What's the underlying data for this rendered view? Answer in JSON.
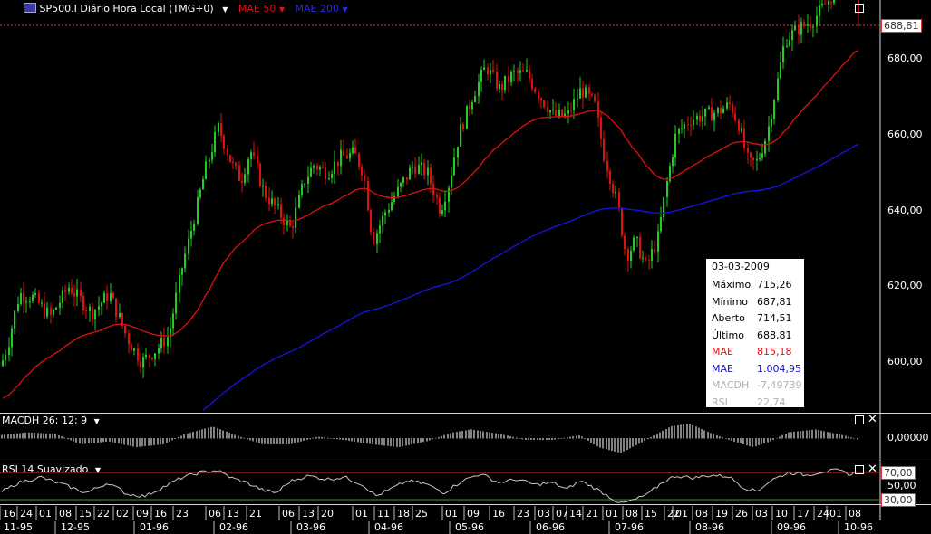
{
  "header": {
    "symbol_icon": "chart-symbol-icon",
    "title": "SP500.I Diário Hora Local (TMG+0)",
    "mae50_label": "MAE 50",
    "mae200_label": "MAE 200"
  },
  "colors": {
    "up": "#22cc22",
    "down": "#e01010",
    "mae50": "#e01010",
    "mae200": "#1010e0",
    "background": "#000000",
    "tooltip": "#ffffff"
  },
  "price_panel": {
    "last_price_tag": "688,81",
    "y_ticks": [
      "680,00",
      "660,00",
      "640,00",
      "620,00",
      "600,00"
    ]
  },
  "macd_panel": {
    "label": "MACDH 26; 12; 9",
    "zero_tick": "0,00000"
  },
  "rsi_panel": {
    "label": "RSI 14 Suavizado",
    "tick_70": "70,00",
    "tick_50": "50,00",
    "tick_30": "30,00"
  },
  "tooltip": {
    "date": "03-03-2009",
    "rows": [
      {
        "label": "Máximo",
        "value": "715,26",
        "color": "#000000"
      },
      {
        "label": "Mínimo",
        "value": "687,81",
        "color": "#000000"
      },
      {
        "label": "Aberto",
        "value": "714,51",
        "color": "#000000"
      },
      {
        "label": "Último",
        "value": "688,81",
        "color": "#000000"
      },
      {
        "label": "MAE",
        "value": "815,18",
        "color": "#e01010"
      },
      {
        "label": "MAE",
        "value": "1.004,95",
        "color": "#1010c0"
      },
      {
        "label": "MACDH",
        "value": "-7,49739",
        "color": "#b0b0b0"
      },
      {
        "label": "RSI",
        "value": "22,74",
        "color": "#b0b0b0"
      }
    ]
  },
  "chart_data": {
    "type": "candlestick",
    "ylim": [
      590,
      695
    ],
    "x_day_labels": [
      "16",
      "24",
      "01",
      "08",
      "15",
      "22",
      "02",
      "09",
      "16",
      "23",
      "06",
      "13",
      "21",
      "06",
      "13",
      "20",
      "01",
      "11",
      "18",
      "25",
      "01",
      "09",
      "16",
      "23",
      "03",
      "07",
      "14",
      "21",
      "01",
      "08",
      "15",
      "22",
      "01",
      "08",
      "19",
      "26",
      "03",
      "10",
      "17",
      "24",
      "01",
      "08"
    ],
    "x_month_labels": [
      "11-95",
      "12-95",
      "01-96",
      "02-96",
      "03-96",
      "04-96",
      "05-96",
      "06-96",
      "07-96",
      "08-96",
      "09-96",
      "10-96"
    ],
    "close_anchors": [
      [
        0,
        599
      ],
      [
        8,
        605
      ],
      [
        20,
        618
      ],
      [
        35,
        617
      ],
      [
        55,
        612
      ],
      [
        75,
        620
      ],
      [
        100,
        613
      ],
      [
        120,
        618
      ],
      [
        140,
        606
      ],
      [
        155,
        600
      ],
      [
        170,
        603
      ],
      [
        185,
        607
      ],
      [
        200,
        625
      ],
      [
        215,
        640
      ],
      [
        225,
        650
      ],
      [
        240,
        662
      ],
      [
        255,
        652
      ],
      [
        265,
        648
      ],
      [
        275,
        656
      ],
      [
        290,
        645
      ],
      [
        305,
        640
      ],
      [
        320,
        635
      ],
      [
        335,
        648
      ],
      [
        345,
        652
      ],
      [
        360,
        650
      ],
      [
        375,
        654
      ],
      [
        390,
        655
      ],
      [
        400,
        650
      ],
      [
        410,
        632
      ],
      [
        425,
        640
      ],
      [
        440,
        646
      ],
      [
        455,
        652
      ],
      [
        470,
        650
      ],
      [
        485,
        640
      ],
      [
        495,
        648
      ],
      [
        505,
        660
      ],
      [
        520,
        670
      ],
      [
        535,
        678
      ],
      [
        550,
        672
      ],
      [
        565,
        676
      ],
      [
        580,
        676
      ],
      [
        595,
        670
      ],
      [
        610,
        665
      ],
      [
        625,
        665
      ],
      [
        640,
        672
      ],
      [
        655,
        668
      ],
      [
        665,
        655
      ],
      [
        680,
        642
      ],
      [
        690,
        628
      ],
      [
        700,
        632
      ],
      [
        712,
        625
      ],
      [
        725,
        633
      ],
      [
        735,
        648
      ],
      [
        745,
        660
      ],
      [
        760,
        664
      ],
      [
        775,
        665
      ],
      [
        790,
        666
      ],
      [
        805,
        668
      ],
      [
        815,
        662
      ],
      [
        825,
        652
      ],
      [
        835,
        653
      ],
      [
        845,
        660
      ],
      [
        855,
        672
      ],
      [
        865,
        685
      ],
      [
        880,
        688
      ],
      [
        895,
        690
      ],
      [
        905,
        693
      ],
      [
        915,
        696
      ],
      [
        925,
        700
      ],
      [
        940,
        702
      ],
      [
        948,
        689
      ]
    ],
    "macd_anchors": [
      [
        0,
        1
      ],
      [
        30,
        2
      ],
      [
        60,
        1.5
      ],
      [
        90,
        -2
      ],
      [
        120,
        -1
      ],
      [
        150,
        -3
      ],
      [
        180,
        -2
      ],
      [
        205,
        1.5
      ],
      [
        235,
        4
      ],
      [
        260,
        1
      ],
      [
        290,
        -2
      ],
      [
        320,
        -2
      ],
      [
        350,
        0.5
      ],
      [
        380,
        -0.5
      ],
      [
        410,
        -2
      ],
      [
        440,
        -3
      ],
      [
        470,
        -1
      ],
      [
        500,
        2
      ],
      [
        520,
        3
      ],
      [
        550,
        1.5
      ],
      [
        580,
        -0.5
      ],
      [
        610,
        -0.5
      ],
      [
        640,
        1
      ],
      [
        660,
        -3
      ],
      [
        685,
        -5
      ],
      [
        710,
        -1
      ],
      [
        740,
        4
      ],
      [
        760,
        5
      ],
      [
        790,
        1
      ],
      [
        810,
        -1
      ],
      [
        830,
        -3
      ],
      [
        850,
        -1
      ],
      [
        870,
        2
      ],
      [
        900,
        3
      ],
      [
        930,
        1
      ],
      [
        948,
        -0.5
      ]
    ],
    "rsi_anchors": [
      [
        0,
        40
      ],
      [
        20,
        55
      ],
      [
        45,
        63
      ],
      [
        70,
        52
      ],
      [
        95,
        40
      ],
      [
        120,
        55
      ],
      [
        140,
        38
      ],
      [
        160,
        35
      ],
      [
        175,
        45
      ],
      [
        200,
        62
      ],
      [
        220,
        70
      ],
      [
        240,
        73
      ],
      [
        255,
        62
      ],
      [
        270,
        56
      ],
      [
        290,
        44
      ],
      [
        305,
        40
      ],
      [
        320,
        57
      ],
      [
        340,
        65
      ],
      [
        360,
        60
      ],
      [
        380,
        63
      ],
      [
        400,
        52
      ],
      [
        415,
        35
      ],
      [
        430,
        45
      ],
      [
        450,
        58
      ],
      [
        470,
        53
      ],
      [
        490,
        40
      ],
      [
        510,
        58
      ],
      [
        530,
        68
      ],
      [
        550,
        55
      ],
      [
        570,
        60
      ],
      [
        590,
        52
      ],
      [
        610,
        55
      ],
      [
        625,
        45
      ],
      [
        640,
        58
      ],
      [
        655,
        48
      ],
      [
        670,
        36
      ],
      [
        685,
        24
      ],
      [
        700,
        30
      ],
      [
        715,
        38
      ],
      [
        730,
        55
      ],
      [
        745,
        65
      ],
      [
        765,
        62
      ],
      [
        785,
        66
      ],
      [
        805,
        64
      ],
      [
        820,
        48
      ],
      [
        835,
        42
      ],
      [
        850,
        58
      ],
      [
        870,
        70
      ],
      [
        890,
        66
      ],
      [
        910,
        72
      ],
      [
        925,
        73
      ],
      [
        940,
        66
      ],
      [
        948,
        75
      ]
    ]
  }
}
